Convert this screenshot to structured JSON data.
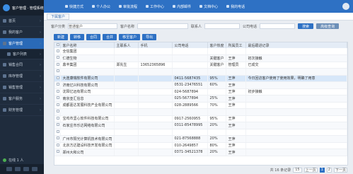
{
  "app": {
    "title": "客户管理 · 管理系统",
    "user": "在线 1 人"
  },
  "sidebar": {
    "items": [
      {
        "label": "首页"
      },
      {
        "label": "我的客户"
      },
      {
        "label": "客户管理",
        "active": true
      },
      {
        "label": "客户列表",
        "sub": true
      },
      {
        "label": "销售合同"
      },
      {
        "label": "库存管理"
      },
      {
        "label": "销售管理"
      },
      {
        "label": "客户服务"
      },
      {
        "label": "财务管理"
      }
    ]
  },
  "topbar": {
    "menu": [
      "快捷方式",
      "个人办公",
      "审批流程",
      "工作中心",
      "内部邮件",
      "文档中心",
      "我的电话"
    ]
  },
  "tabs": [
    "下属客户"
  ],
  "filter": {
    "label1": "客户分类",
    "value1": "普通客户",
    "label2": "客户名称",
    "value2": "",
    "label3": "联系人",
    "value3": "",
    "label4": "公司电话",
    "btn_search": "搜索",
    "btn_adv": "高级查询"
  },
  "toolbar": [
    "新建",
    "转移",
    "合同",
    "合并",
    "移至客户",
    "导出"
  ],
  "table": {
    "headers": [
      "",
      "客户名称",
      "主联系人",
      "手机",
      "公司电话",
      "客户热度",
      "所属员工",
      "最后跟进记录"
    ],
    "rows": [
      [
        "",
        "全信集团",
        "",
        "",
        "",
        "",
        "",
        ""
      ],
      [
        "",
        "仁德生物",
        "",
        "",
        "",
        "关键客户",
        "王萍",
        "初次接触"
      ],
      [
        "",
        "鼎丰集团",
        "郑先生",
        "13652365896",
        "",
        "关键客户",
        "管理员",
        "已成交"
      ],
      [
        "",
        "",
        "",
        "",
        "",
        "",
        "",
        ""
      ],
      [
        "",
        "大连康瑞软件有限公司",
        "",
        "",
        "0411-5687435",
        "95%",
        "王萍",
        "今日回访客户使用了使用效果，明确了用意"
      ],
      [
        "",
        "济南亿兴科技有限公司",
        "",
        "",
        "0531-23476551",
        "60%",
        "王萍",
        ""
      ],
      [
        "",
        "沈阳亿远有限公司",
        "",
        "",
        "024-5687894",
        "",
        "王萍",
        "初步接触"
      ],
      [
        "",
        "南京亚汇信息",
        "",
        "",
        "025-5677894",
        "25%",
        "王萍",
        ""
      ],
      [
        "",
        "成都嘉达发展科技产业有限公司",
        "",
        "",
        "028-2889566",
        "70%",
        "王萍",
        ""
      ],
      [
        "",
        "",
        "",
        "",
        "",
        "",
        "",
        ""
      ],
      [
        "",
        "宝鸡市坚心软件科技有限公司",
        "",
        "",
        "0917-2560955",
        "95%",
        "王萍",
        ""
      ],
      [
        "",
        "石家庄市乐达网络有限公司",
        "",
        "",
        "0311-85478995",
        "20%",
        "王萍",
        ""
      ],
      [
        "",
        "",
        "",
        "",
        "",
        "",
        "",
        ""
      ],
      [
        "",
        "广州市阳光计算机技术有限公司",
        "",
        "",
        "021-87568888",
        "20%",
        "王萍",
        ""
      ],
      [
        "",
        "北京方达建设科技开发有限公司",
        "",
        "",
        "010-2649857",
        "80%",
        "王萍",
        ""
      ],
      [
        "",
        "郑州大和公司",
        "",
        "",
        "0371-34521378",
        "20%",
        "王萍",
        ""
      ]
    ]
  },
  "pager": {
    "per_page": "15",
    "prev": "上一页",
    "pages": [
      "1",
      "2"
    ],
    "current": "1",
    "next": "下一页",
    "summary": "共 16 条记录"
  }
}
